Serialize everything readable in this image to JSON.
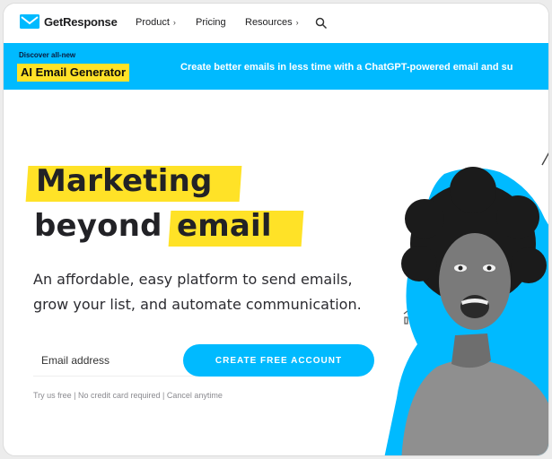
{
  "nav": {
    "logo": "GetResponse",
    "items": [
      {
        "label": "Product",
        "chevron": "›"
      },
      {
        "label": "Pricing",
        "chevron": ""
      },
      {
        "label": "Resources",
        "chevron": "›"
      }
    ],
    "search_icon": "search-icon"
  },
  "banner": {
    "eyebrow": "Discover all-new",
    "headline": "AI Email Generator",
    "text": "Create better emails in less time with a ChatGPT-powered email and su"
  },
  "hero": {
    "line1": "Marketing",
    "line2_a": "beyond",
    "line2_b": "email",
    "sub1": "An affordable, easy platform to send emails,",
    "sub2": "grow your list, and automate communication.",
    "email_placeholder": "Email address",
    "cta": "CREATE FREE ACCOUNT",
    "fine_print": "Try us free | No credit card required | Cancel anytime"
  },
  "colors": {
    "brand_blue": "#00baff",
    "highlight_yellow": "#ffe227",
    "text_dark": "#222226"
  }
}
